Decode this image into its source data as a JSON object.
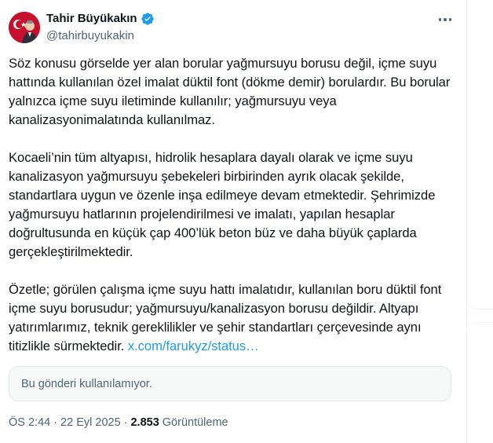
{
  "author": {
    "name": "Tahir Büyükakın",
    "handle": "@tahirbuyukakin",
    "verified": true,
    "verified_color": "#1d9bf0"
  },
  "tweet": {
    "paragraphs": [
      "Söz konusu görselde yer alan borular yağmursuyu borusu değil, içme suyu hattında kullanılan özel imalat düktil font (dökme demir) borulardır. Bu borular yalnızca içme suyu iletiminde kullanılır; yağmursuyu veya kanalizasyonimalatında kullanılmaz.",
      "Kocaeli’nin tüm altyapısı, hidrolik hesaplara dayalı olarak ve içme suyu kanalizasyon yağmursuyu şebekeleri birbirinden ayrık olacak şekilde, standartlara uygun ve özenle inşa edilmeye devam etmektedir. Şehrimizde yağmursuyu hatlarının projelendirilmesi ve imalatı, yapılan hesaplar doğrultusunda en küçük çap 400’lük beton büz ve daha büyük çaplarda gerçekleştirilmektedir."
    ],
    "last_paragraph": "Özetle; görülen çalışma içme suyu hattı imalatıdır, kullanılan boru düktil font içme suyu borusudur; yağmursuyu/kanalizasyon borusu değildir. Altyapı yatırımlarımız, teknik gereklilikler ve şehir standartları çerçevesinde aynı titizlikle sürmektedir.",
    "link": "x.com/farukyz/status…",
    "unavailable_text": "Bu gönderi kullanılamıyor.",
    "time": "ÖS 2:44",
    "date": "22 Eyl 2025",
    "views_count": "2.853",
    "views_label": "Görüntüleme"
  },
  "colors": {
    "link": "#1d9bf0",
    "secondary_text": "#536471",
    "avatar_red": "#c8102e"
  }
}
